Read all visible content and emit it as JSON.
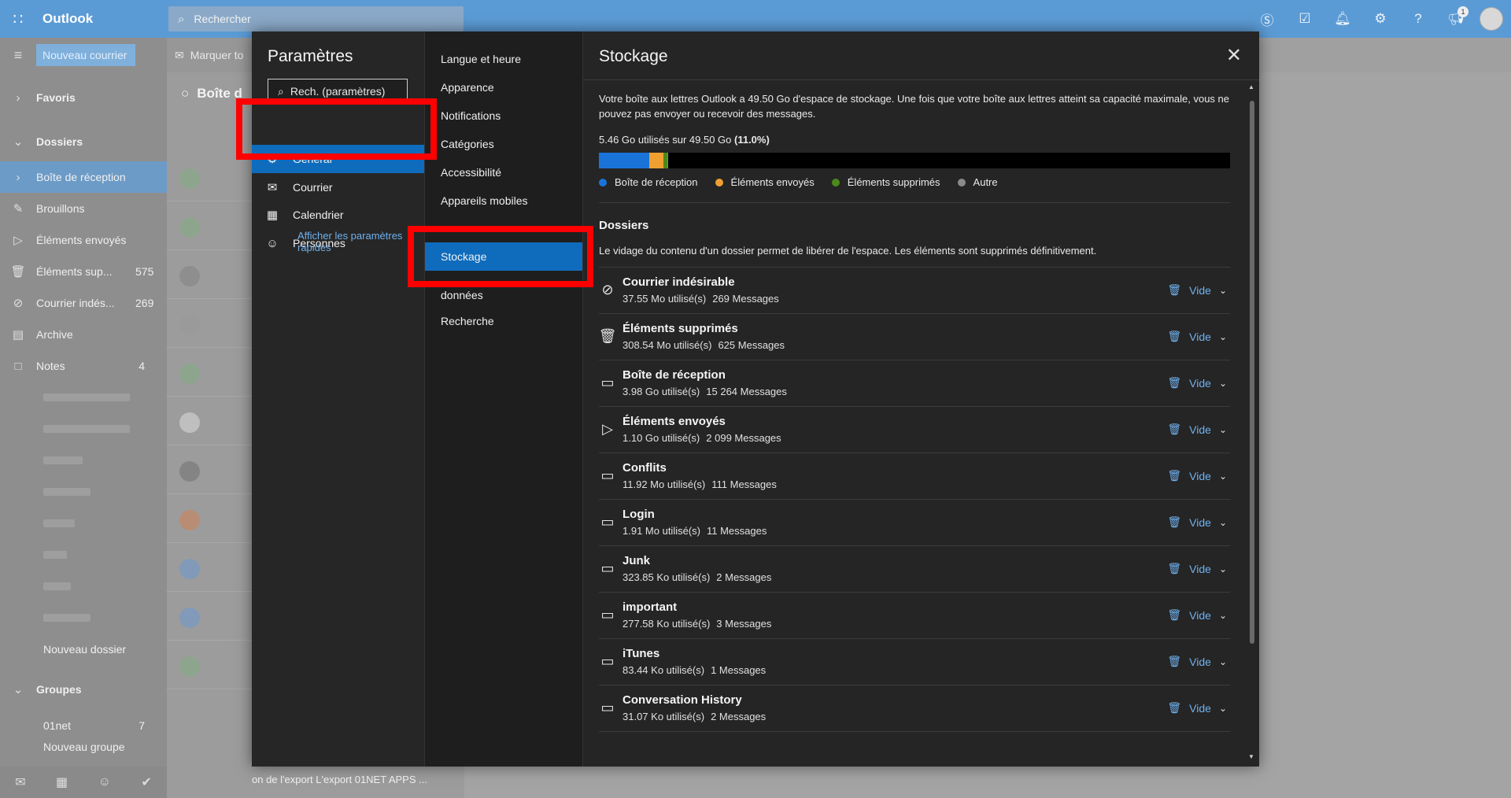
{
  "topbar": {
    "app_name": "Outlook",
    "search_placeholder": "Rechercher",
    "notif_badge": "1",
    "accent": "#5b9bd5"
  },
  "leftnav": {
    "new_mail": "Nouveau courrier",
    "favoris": "Favoris",
    "dossiers": "Dossiers",
    "items": [
      {
        "label": "Boîte de réception",
        "count": ""
      },
      {
        "label": "Brouillons",
        "count": ""
      },
      {
        "label": "Éléments envoyés",
        "count": ""
      },
      {
        "label": "Éléments sup...",
        "count": "575"
      },
      {
        "label": "Courrier indés...",
        "count": "269"
      },
      {
        "label": "Archive",
        "count": ""
      },
      {
        "label": "Notes",
        "count": "4"
      }
    ],
    "new_folder": "Nouveau dossier",
    "groupes": "Groupes",
    "group_item": {
      "label": "01net",
      "count": "7"
    },
    "new_group": "Nouveau groupe"
  },
  "msglist": {
    "mark_label": "Marquer to",
    "heading": "Boîte d",
    "footer": "on de l'export L'export 01NET APPS ..."
  },
  "settings": {
    "title": "Paramètres",
    "search_placeholder": "Rech. (paramètres)",
    "categories": [
      {
        "label": "Général",
        "icon": "gear-icon"
      },
      {
        "label": "Courrier",
        "icon": "mail-icon"
      },
      {
        "label": "Calendrier",
        "icon": "calendar-icon"
      },
      {
        "label": "Personnes",
        "icon": "people-icon"
      }
    ],
    "quick_link": "Afficher les paramètres rapides",
    "subcategories": [
      "Langue et heure",
      "Apparence",
      "Notifications",
      "Catégories",
      "Accessibilité",
      "Appareils mobiles",
      "Stockage",
      "données",
      "Recherche"
    ],
    "highlight_color": "#ff0000",
    "active_color": "#0f6cbd"
  },
  "storage": {
    "title": "Stockage",
    "intro": "Votre boîte aux lettres Outlook a 49.50 Go d'espace de stockage. Une fois que votre boîte aux lettres atteint sa capacité maximale, vous ne pouvez pas envoyer ou recevoir des messages.",
    "usage_prefix": "5.46 Go utilisés sur 49.50 Go",
    "usage_percent": "(11.0%)",
    "bar": [
      {
        "name": "Boîte de réception",
        "fraction": 0.0804,
        "color": "#1a73d9"
      },
      {
        "name": "Éléments envoyés",
        "fraction": 0.0222,
        "color": "#f0a030"
      },
      {
        "name": "Éléments supprimés",
        "fraction": 0.0062,
        "color": "#4a8a1a"
      },
      {
        "name": "Autre",
        "fraction": 0.0012,
        "color": "#8a8a8a"
      }
    ],
    "folders_title": "Dossiers",
    "folders_desc": "Le vidage du contenu d'un dossier permet de libérer de l'espace. Les éléments sont supprimés définitivement.",
    "empty_label": "Vide",
    "folders": [
      {
        "name": "Courrier indésirable",
        "size": "37.55 Mo utilisé(s)",
        "count": "269 Messages",
        "icon": "blocked-icon"
      },
      {
        "name": "Éléments supprimés",
        "size": "308.54 Mo utilisé(s)",
        "count": "625 Messages",
        "icon": "trash-icon"
      },
      {
        "name": "Boîte de réception",
        "size": "3.98 Go utilisé(s)",
        "count": "15 264 Messages",
        "icon": "inbox-icon"
      },
      {
        "name": "Éléments envoyés",
        "size": "1.10 Go utilisé(s)",
        "count": "2 099 Messages",
        "icon": "send-icon"
      },
      {
        "name": "Conflits",
        "size": "11.92 Mo utilisé(s)",
        "count": "111 Messages",
        "icon": "folder-icon"
      },
      {
        "name": "Login",
        "size": "1.91 Mo utilisé(s)",
        "count": "11 Messages",
        "icon": "folder-icon"
      },
      {
        "name": "Junk",
        "size": "323.85 Ko utilisé(s)",
        "count": "2 Messages",
        "icon": "folder-icon"
      },
      {
        "name": "important",
        "size": "277.58 Ko utilisé(s)",
        "count": "3 Messages",
        "icon": "folder-icon"
      },
      {
        "name": "iTunes",
        "size": "83.44 Ko utilisé(s)",
        "count": "1 Messages",
        "icon": "folder-icon"
      },
      {
        "name": "Conversation History",
        "size": "31.07 Ko utilisé(s)",
        "count": "2 Messages",
        "icon": "folder-icon"
      }
    ]
  }
}
